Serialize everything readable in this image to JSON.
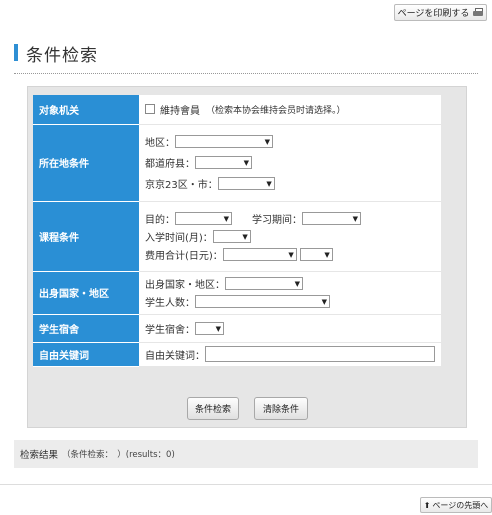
{
  "header": {
    "print_label": "ページを印刷する",
    "print_icon": "printer-icon"
  },
  "page": {
    "title": "条件检索"
  },
  "form": {
    "target_org": {
      "label": "对象机关",
      "checkbox_label": "維持會員",
      "checkbox_checked": false,
      "note": "（检索本协会维持会员时请选择。）"
    },
    "location": {
      "label": "所在地条件",
      "region_label": "地区：",
      "prefecture_label": "都道府县：",
      "city_label": "京京23区・市："
    },
    "course": {
      "label": "课程条件",
      "purpose_label": "目的：",
      "study_period_label": "学习期间：",
      "enroll_month_label": "入学时间(月)：",
      "total_cost_label": "费用合计(日元)："
    },
    "origin": {
      "label": "出身国家・地区",
      "country_label": "出身国家・地区：",
      "student_count_label": "学生人数："
    },
    "dorm": {
      "label": "学生宿舍",
      "field_label": "学生宿舍："
    },
    "keyword": {
      "label": "自由关键词",
      "field_label": "自由关键词：",
      "value": ""
    },
    "search_button": "条件检索",
    "clear_button": "清除条件"
  },
  "results": {
    "title": "检索结果",
    "detail": "（条件检索：　）(results：0)"
  },
  "footer": {
    "top_label": "ページの先頭へ",
    "top_icon": "arrow-up-icon"
  },
  "colors": {
    "accent": "#2a8fd5",
    "form_bg": "#e6e6e6"
  }
}
